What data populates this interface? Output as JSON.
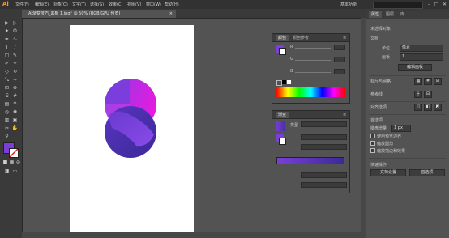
{
  "app": {
    "logo_text": "Ai"
  },
  "menu": [
    "文件(F)",
    "编辑(E)",
    "对象(O)",
    "文字(T)",
    "选择(S)",
    "效果(C)",
    "视图(V)",
    "窗口(W)",
    "帮助(H)"
  ],
  "workspace_label": "基本功能",
  "window_controls": [
    "–",
    "□",
    "✕"
  ],
  "document_tab": {
    "title": "AI渐变技巧_黑板 1.jpg* @ 50% (RGB/GPU 预览)",
    "close": "×"
  },
  "color_panel": {
    "tabs": [
      "颜色",
      "颜色参考"
    ],
    "labels": [
      "R",
      "G",
      "B"
    ]
  },
  "gradient_panel": {
    "tab": "渐变",
    "type_label": "类型"
  },
  "properties": {
    "tabs": [
      "属性",
      "图层",
      "库"
    ],
    "no_selection": "未选择对象",
    "doc_section": "文档",
    "unit_label": "单位",
    "unit_value": "像素",
    "artboard_label": "画板",
    "artboard_value": "1",
    "edit_artboard_button": "编辑画板",
    "ruler_grid": "标尺与网格",
    "guides": "参考线",
    "align_to": "对齐选项",
    "prefs": "首选项",
    "keyboard_increment_label": "键盘增量",
    "keyboard_increment_value": "1 px",
    "checkbox_1": "使用预览边界",
    "checkbox_2": "缩放圆角",
    "checkbox_3": "缩放描边和效果",
    "quick_actions": "快速操作",
    "doc_setup_button": "文档设置",
    "prefs_button": "首选项"
  },
  "colors": {
    "accent_purple": "#7a3fd6",
    "logo_top": "#b23cf0",
    "logo_bottom": "#4a2ea8",
    "magenta": "#e21ce0"
  }
}
